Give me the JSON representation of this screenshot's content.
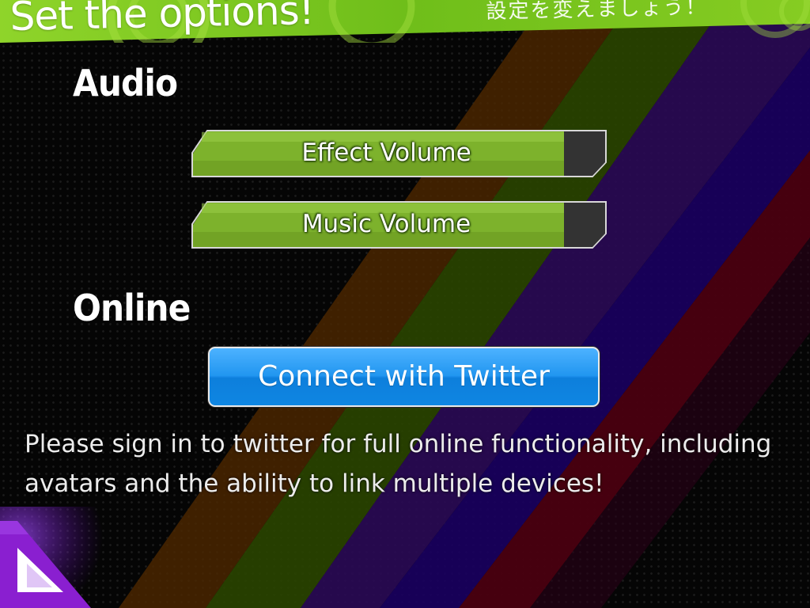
{
  "header": {
    "title": "Set the options!",
    "subtitle_jp": "設定を変えましょう！"
  },
  "sections": {
    "audio": {
      "heading": "Audio",
      "effect_volume": {
        "label": "Effect Volume",
        "level": 0.9
      },
      "music_volume": {
        "label": "Music Volume",
        "level": 0.9
      }
    },
    "online": {
      "heading": "Online",
      "twitter_button_label": "Connect with Twitter",
      "info_text": "Please sign in to twitter for full online functionality, including avatars and the ability to link multiple devices!"
    }
  },
  "icons": {
    "back": "back-triangle-icon"
  },
  "colors": {
    "banner_green": "#7ac41e",
    "slider_fill": "#7db22c",
    "slider_empty": "#333333",
    "twitter_blue": "#1a8fe8",
    "corner_purple": "#8a1fd0",
    "stripe_orange": "#5a2e00",
    "stripe_green": "#2b4a00",
    "stripe_purple": "#330066",
    "stripe_red": "#5a0010",
    "stripe_navy": "#120045"
  }
}
